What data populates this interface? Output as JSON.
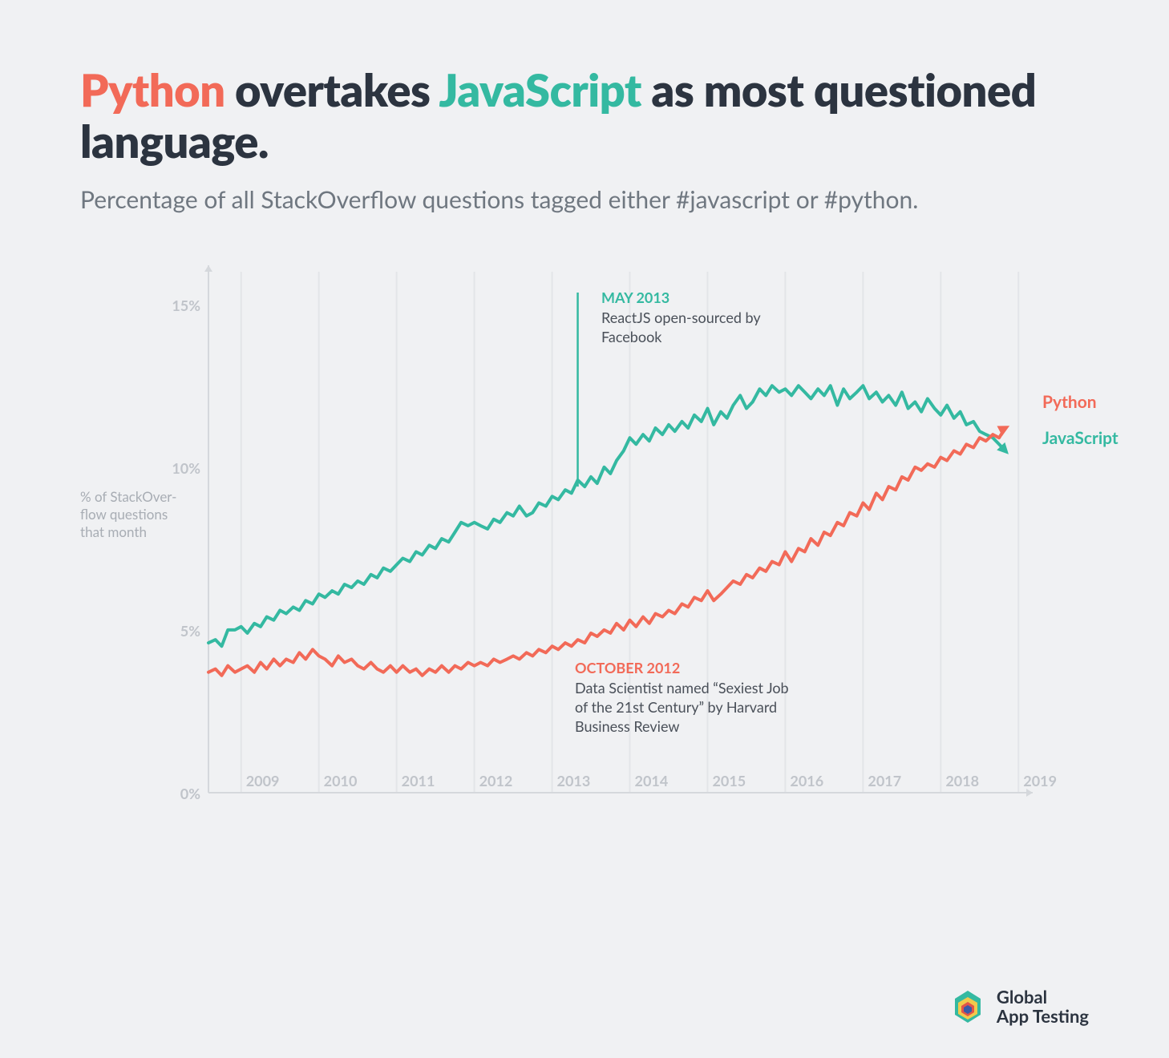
{
  "title": {
    "word_python": "Python",
    "middle1": " overtakes ",
    "word_javascript": "JavaScript",
    "middle2": " as most questioned language."
  },
  "subtitle": "Percentage of all StackOverflow questions tagged either #javascript or #python.",
  "y_axis_title": "% of StackOver-flow questions that month",
  "annotations": {
    "js": {
      "date": "MAY 2013",
      "body": "ReactJS open-sourced by Facebook"
    },
    "py": {
      "date": "OCTOBER 2012",
      "body": "Data Scientist named “Sexiest Job of the 21st Century” by Harvard Business Review"
    }
  },
  "series_labels": {
    "python": "Python",
    "javascript": "JavaScript"
  },
  "footer": {
    "brand1": "Global",
    "brand2": "App Testing"
  },
  "chart_data": {
    "type": "line",
    "xlabel": "",
    "ylabel": "% of StackOverflow questions that month",
    "ylim": [
      0,
      16
    ],
    "y_ticks": [
      0,
      5,
      10,
      15
    ],
    "y_tick_labels": [
      "0%",
      "5%",
      "10%",
      "15%"
    ],
    "x_years": [
      2009,
      2010,
      2011,
      2012,
      2013,
      2014,
      2015,
      2016,
      2017,
      2018,
      2019
    ],
    "x_tick_labels": [
      "2009",
      "2010",
      "2011",
      "2012",
      "2013",
      "2014",
      "2015",
      "2016",
      "2017",
      "2018",
      "2019"
    ],
    "series": [
      {
        "name": "JavaScript",
        "color": "#34b9a1",
        "x": [
          2008.58,
          2008.67,
          2008.75,
          2008.83,
          2008.92,
          2009.0,
          2009.08,
          2009.17,
          2009.25,
          2009.33,
          2009.42,
          2009.5,
          2009.58,
          2009.67,
          2009.75,
          2009.83,
          2009.92,
          2010.0,
          2010.08,
          2010.17,
          2010.25,
          2010.33,
          2010.42,
          2010.5,
          2010.58,
          2010.67,
          2010.75,
          2010.83,
          2010.92,
          2011.0,
          2011.08,
          2011.17,
          2011.25,
          2011.33,
          2011.42,
          2011.5,
          2011.58,
          2011.67,
          2011.75,
          2011.83,
          2011.92,
          2012.0,
          2012.08,
          2012.17,
          2012.25,
          2012.33,
          2012.42,
          2012.5,
          2012.58,
          2012.67,
          2012.75,
          2012.83,
          2012.92,
          2013.0,
          2013.08,
          2013.17,
          2013.25,
          2013.33,
          2013.42,
          2013.5,
          2013.58,
          2013.67,
          2013.75,
          2013.83,
          2013.92,
          2014.0,
          2014.08,
          2014.17,
          2014.25,
          2014.33,
          2014.42,
          2014.5,
          2014.58,
          2014.67,
          2014.75,
          2014.83,
          2014.92,
          2015.0,
          2015.08,
          2015.17,
          2015.25,
          2015.33,
          2015.42,
          2015.5,
          2015.58,
          2015.67,
          2015.75,
          2015.83,
          2015.92,
          2016.0,
          2016.08,
          2016.17,
          2016.25,
          2016.33,
          2016.42,
          2016.5,
          2016.58,
          2016.67,
          2016.75,
          2016.83,
          2016.92,
          2017.0,
          2017.08,
          2017.17,
          2017.25,
          2017.33,
          2017.42,
          2017.5,
          2017.58,
          2017.67,
          2017.75,
          2017.83,
          2017.92,
          2018.0,
          2018.08,
          2018.17,
          2018.25,
          2018.33,
          2018.42,
          2018.5,
          2018.58,
          2018.67,
          2018.75,
          2018.83
        ],
        "values": [
          4.6,
          4.7,
          4.5,
          5.0,
          5.0,
          5.1,
          4.9,
          5.2,
          5.1,
          5.4,
          5.3,
          5.6,
          5.5,
          5.7,
          5.6,
          5.9,
          5.8,
          6.1,
          6.0,
          6.2,
          6.1,
          6.4,
          6.3,
          6.5,
          6.4,
          6.7,
          6.6,
          6.9,
          6.8,
          7.0,
          7.2,
          7.1,
          7.4,
          7.3,
          7.6,
          7.5,
          7.8,
          7.7,
          8.0,
          8.3,
          8.2,
          8.3,
          8.2,
          8.1,
          8.4,
          8.3,
          8.6,
          8.5,
          8.8,
          8.5,
          8.6,
          8.9,
          8.8,
          9.1,
          9.0,
          9.3,
          9.2,
          9.6,
          9.4,
          9.7,
          9.5,
          10.0,
          9.8,
          10.2,
          10.5,
          10.9,
          10.7,
          11.0,
          10.8,
          11.2,
          11.0,
          11.3,
          11.1,
          11.4,
          11.2,
          11.6,
          11.4,
          11.8,
          11.3,
          11.7,
          11.5,
          11.9,
          12.2,
          11.8,
          12.0,
          12.4,
          12.2,
          12.5,
          12.3,
          12.4,
          12.2,
          12.5,
          12.3,
          12.1,
          12.4,
          12.2,
          12.5,
          11.9,
          12.4,
          12.1,
          12.3,
          12.5,
          12.1,
          12.3,
          12.0,
          12.2,
          11.9,
          12.3,
          11.8,
          12.0,
          11.7,
          12.1,
          11.8,
          11.6,
          11.9,
          11.5,
          11.7,
          11.3,
          11.4,
          11.1,
          11.0,
          10.9,
          10.7,
          10.5
        ]
      },
      {
        "name": "Python",
        "color": "#f26a58",
        "x": [
          2008.58,
          2008.67,
          2008.75,
          2008.83,
          2008.92,
          2009.0,
          2009.08,
          2009.17,
          2009.25,
          2009.33,
          2009.42,
          2009.5,
          2009.58,
          2009.67,
          2009.75,
          2009.83,
          2009.92,
          2010.0,
          2010.08,
          2010.17,
          2010.25,
          2010.33,
          2010.42,
          2010.5,
          2010.58,
          2010.67,
          2010.75,
          2010.83,
          2010.92,
          2011.0,
          2011.08,
          2011.17,
          2011.25,
          2011.33,
          2011.42,
          2011.5,
          2011.58,
          2011.67,
          2011.75,
          2011.83,
          2011.92,
          2012.0,
          2012.08,
          2012.17,
          2012.25,
          2012.33,
          2012.42,
          2012.5,
          2012.58,
          2012.67,
          2012.75,
          2012.83,
          2012.92,
          2013.0,
          2013.08,
          2013.17,
          2013.25,
          2013.33,
          2013.42,
          2013.5,
          2013.58,
          2013.67,
          2013.75,
          2013.83,
          2013.92,
          2014.0,
          2014.08,
          2014.17,
          2014.25,
          2014.33,
          2014.42,
          2014.5,
          2014.58,
          2014.67,
          2014.75,
          2014.83,
          2014.92,
          2015.0,
          2015.08,
          2015.17,
          2015.25,
          2015.33,
          2015.42,
          2015.5,
          2015.58,
          2015.67,
          2015.75,
          2015.83,
          2015.92,
          2016.0,
          2016.08,
          2016.17,
          2016.25,
          2016.33,
          2016.42,
          2016.5,
          2016.58,
          2016.67,
          2016.75,
          2016.83,
          2016.92,
          2017.0,
          2017.08,
          2017.17,
          2017.25,
          2017.33,
          2017.42,
          2017.5,
          2017.58,
          2017.67,
          2017.75,
          2017.83,
          2017.92,
          2018.0,
          2018.08,
          2018.17,
          2018.25,
          2018.33,
          2018.42,
          2018.5,
          2018.58,
          2018.67,
          2018.75,
          2018.83
        ],
        "values": [
          3.7,
          3.8,
          3.6,
          3.9,
          3.7,
          3.8,
          3.9,
          3.7,
          4.0,
          3.8,
          4.1,
          3.9,
          4.1,
          4.0,
          4.3,
          4.1,
          4.4,
          4.2,
          4.1,
          3.9,
          4.2,
          4.0,
          4.1,
          3.9,
          3.8,
          4.0,
          3.8,
          3.7,
          3.9,
          3.7,
          3.9,
          3.7,
          3.8,
          3.6,
          3.8,
          3.7,
          3.9,
          3.7,
          3.9,
          3.8,
          4.0,
          3.9,
          4.0,
          3.9,
          4.1,
          4.0,
          4.1,
          4.2,
          4.1,
          4.3,
          4.2,
          4.4,
          4.3,
          4.5,
          4.4,
          4.6,
          4.5,
          4.7,
          4.6,
          4.9,
          4.8,
          5.0,
          4.9,
          5.2,
          5.0,
          5.3,
          5.1,
          5.4,
          5.2,
          5.5,
          5.4,
          5.6,
          5.5,
          5.8,
          5.7,
          6.0,
          5.9,
          6.2,
          5.9,
          6.1,
          6.3,
          6.5,
          6.4,
          6.7,
          6.6,
          6.9,
          6.8,
          7.1,
          7.0,
          7.4,
          7.1,
          7.5,
          7.4,
          7.8,
          7.6,
          8.0,
          7.9,
          8.3,
          8.2,
          8.6,
          8.5,
          8.9,
          8.7,
          9.2,
          9.0,
          9.4,
          9.3,
          9.7,
          9.6,
          10.0,
          9.9,
          10.1,
          10.0,
          10.3,
          10.2,
          10.5,
          10.4,
          10.7,
          10.6,
          10.9,
          10.8,
          11.0,
          10.9,
          11.2
        ]
      }
    ],
    "annotations": [
      {
        "series": "JavaScript",
        "x": 2013.33,
        "label": "MAY 2013 — ReactJS open-sourced by Facebook"
      },
      {
        "series": "Python",
        "x": 2012.75,
        "label": "OCTOBER 2012 — Data Scientist named 'Sexiest Job of the 21st Century' by Harvard Business Review"
      }
    ]
  }
}
